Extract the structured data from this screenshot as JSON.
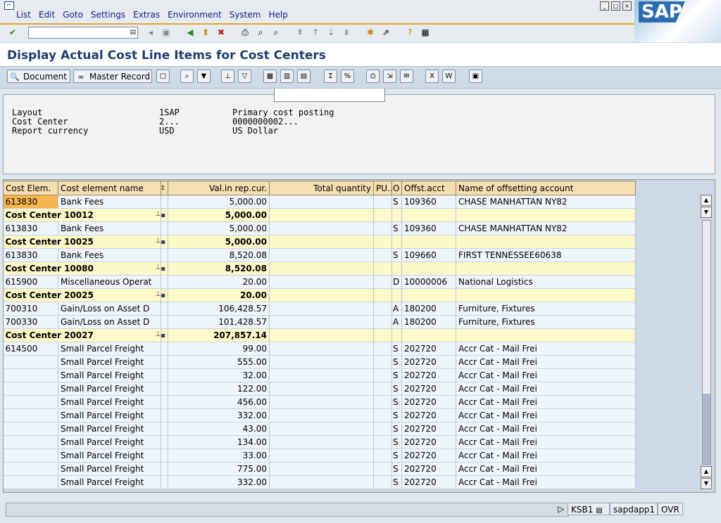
{
  "menu": [
    "List",
    "Edit",
    "Goto",
    "Settings",
    "Extras",
    "Environment",
    "System",
    "Help"
  ],
  "logo": "SAP",
  "command_field": {
    "value": ""
  },
  "title": "Display Actual Cost Line Items for Cost Centers",
  "app_toolbar": {
    "document": "Document",
    "master_record": "Master Record"
  },
  "header": [
    {
      "label": "Layout",
      "value": "1SAP",
      "desc": "Primary cost posting"
    },
    {
      "label": "Cost Center",
      "value": "2...",
      "desc": "0000000002..."
    },
    {
      "label": "Report currency",
      "value": "USD",
      "desc": "US Dollar"
    }
  ],
  "columns": [
    "Cost Elem.",
    "Cost element name",
    "Σ",
    "Val.in rep.cur.",
    "Total quantity",
    "PU...",
    "O",
    "Offst.acct",
    "Name of offsetting account"
  ],
  "rows": [
    {
      "type": "item",
      "ce": "613830",
      "name": "Bank Fees",
      "val": "5,000.00",
      "o": "S",
      "acct": "109360",
      "acct_name": "CHASE MANHATTAN NY82"
    },
    {
      "type": "sub",
      "label": "Cost Center 10012",
      "val": "5,000.00"
    },
    {
      "type": "item",
      "ce": "613830",
      "name": "Bank Fees",
      "val": "5,000.00",
      "o": "S",
      "acct": "109360",
      "acct_name": "CHASE MANHATTAN NY82"
    },
    {
      "type": "sub",
      "label": "Cost Center 10025",
      "val": "5,000.00"
    },
    {
      "type": "item",
      "ce": "613830",
      "name": "Bank Fees",
      "val": "8,520.08",
      "o": "S",
      "acct": "109660",
      "acct_name": "FIRST TENNESSEE60638"
    },
    {
      "type": "sub",
      "label": "Cost Center 10080",
      "val": "8,520.08"
    },
    {
      "type": "item",
      "ce": "615900",
      "name": "Miscellaneous Operat",
      "val": "20.00",
      "o": "D",
      "acct": "10000006",
      "acct_name": "National Logistics"
    },
    {
      "type": "sub",
      "label": "Cost Center 20025",
      "val": "20.00"
    },
    {
      "type": "item",
      "ce": "700310",
      "name": "Gain/Loss on Asset D",
      "val": "106,428.57",
      "o": "A",
      "acct": "180200",
      "acct_name": "Furniture, Fixtures"
    },
    {
      "type": "item",
      "ce": "700330",
      "name": "Gain/Loss on Asset D",
      "val": "101,428.57",
      "o": "A",
      "acct": "180200",
      "acct_name": "Furniture, Fixtures"
    },
    {
      "type": "sub",
      "label": "Cost Center 20027",
      "val": "207,857.14"
    },
    {
      "type": "item",
      "ce": "614500",
      "name": "Small Parcel Freight",
      "val": "99.00",
      "o": "S",
      "acct": "202720",
      "acct_name": "Accr Cat - Mail Frei"
    },
    {
      "type": "item",
      "ce": "",
      "name": "Small Parcel Freight",
      "val": "555.00",
      "o": "S",
      "acct": "202720",
      "acct_name": "Accr Cat - Mail Frei"
    },
    {
      "type": "item",
      "ce": "",
      "name": "Small Parcel Freight",
      "val": "32.00",
      "o": "S",
      "acct": "202720",
      "acct_name": "Accr Cat - Mail Frei"
    },
    {
      "type": "item",
      "ce": "",
      "name": "Small Parcel Freight",
      "val": "122.00",
      "o": "S",
      "acct": "202720",
      "acct_name": "Accr Cat - Mail Frei"
    },
    {
      "type": "item",
      "ce": "",
      "name": "Small Parcel Freight",
      "val": "456.00",
      "o": "S",
      "acct": "202720",
      "acct_name": "Accr Cat - Mail Frei"
    },
    {
      "type": "item",
      "ce": "",
      "name": "Small Parcel Freight",
      "val": "332.00",
      "o": "S",
      "acct": "202720",
      "acct_name": "Accr Cat - Mail Frei"
    },
    {
      "type": "item",
      "ce": "",
      "name": "Small Parcel Freight",
      "val": "43.00",
      "o": "S",
      "acct": "202720",
      "acct_name": "Accr Cat - Mail Frei"
    },
    {
      "type": "item",
      "ce": "",
      "name": "Small Parcel Freight",
      "val": "134.00",
      "o": "S",
      "acct": "202720",
      "acct_name": "Accr Cat - Mail Frei"
    },
    {
      "type": "item",
      "ce": "",
      "name": "Small Parcel Freight",
      "val": "33.00",
      "o": "S",
      "acct": "202720",
      "acct_name": "Accr Cat - Mail Frei"
    },
    {
      "type": "item",
      "ce": "",
      "name": "Small Parcel Freight",
      "val": "775.00",
      "o": "S",
      "acct": "202720",
      "acct_name": "Accr Cat - Mail Frei"
    },
    {
      "type": "item",
      "ce": "",
      "name": "Small Parcel Freight",
      "val": "332.00",
      "o": "S",
      "acct": "202720",
      "acct_name": "Accr Cat - Mail Frei"
    }
  ],
  "status": {
    "transaction": "KSB1",
    "server": "sapdapp1",
    "mode": "OVR"
  },
  "colors": {
    "header_bg": "#f5deb0",
    "subtotal_bg": "#fdf8c8",
    "row_bg": "#eef5fa",
    "title": "#1f3f6e",
    "accent": "#e8a530"
  }
}
